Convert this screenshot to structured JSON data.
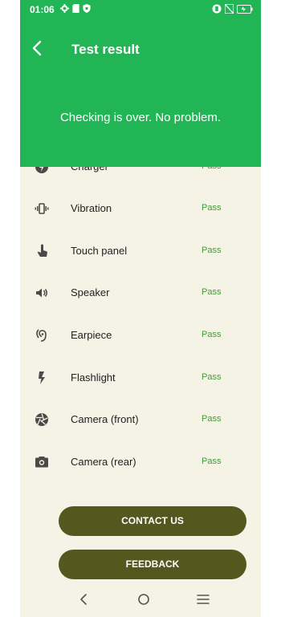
{
  "status_bar": {
    "time": "01:06",
    "left_icons": [
      "settings-gear-icon",
      "sim-card-icon",
      "shield-icon"
    ],
    "right_icons": [
      "vibrate-icon",
      "no-sim-icon",
      "battery-charging-icon"
    ]
  },
  "toolbar": {
    "title": "Test result"
  },
  "result": {
    "message": "Checking is over. No problem."
  },
  "tests": [
    {
      "name": "Charger",
      "status": "Pass",
      "icon": "charger-icon"
    },
    {
      "name": "Vibration",
      "status": "Pass",
      "icon": "vibration-icon"
    },
    {
      "name": "Touch panel",
      "status": "Pass",
      "icon": "touch-icon"
    },
    {
      "name": "Speaker",
      "status": "Pass",
      "icon": "speaker-icon"
    },
    {
      "name": "Earpiece",
      "status": "Pass",
      "icon": "earpiece-icon"
    },
    {
      "name": "Flashlight",
      "status": "Pass",
      "icon": "flashlight-icon"
    },
    {
      "name": "Camera (front)",
      "status": "Pass",
      "icon": "camera-front-icon"
    },
    {
      "name": "Camera (rear)",
      "status": "Pass",
      "icon": "camera-rear-icon"
    }
  ],
  "buttons": {
    "contact": "CONTACT US",
    "feedback": "FEEDBACK"
  },
  "colors": {
    "header_green": "#22b556",
    "pass_green": "#3d9e33",
    "button_olive": "#54571e",
    "list_background": "#f4f3e6"
  },
  "nav": [
    "back-nav-icon",
    "home-nav-icon",
    "recents-nav-icon"
  ]
}
